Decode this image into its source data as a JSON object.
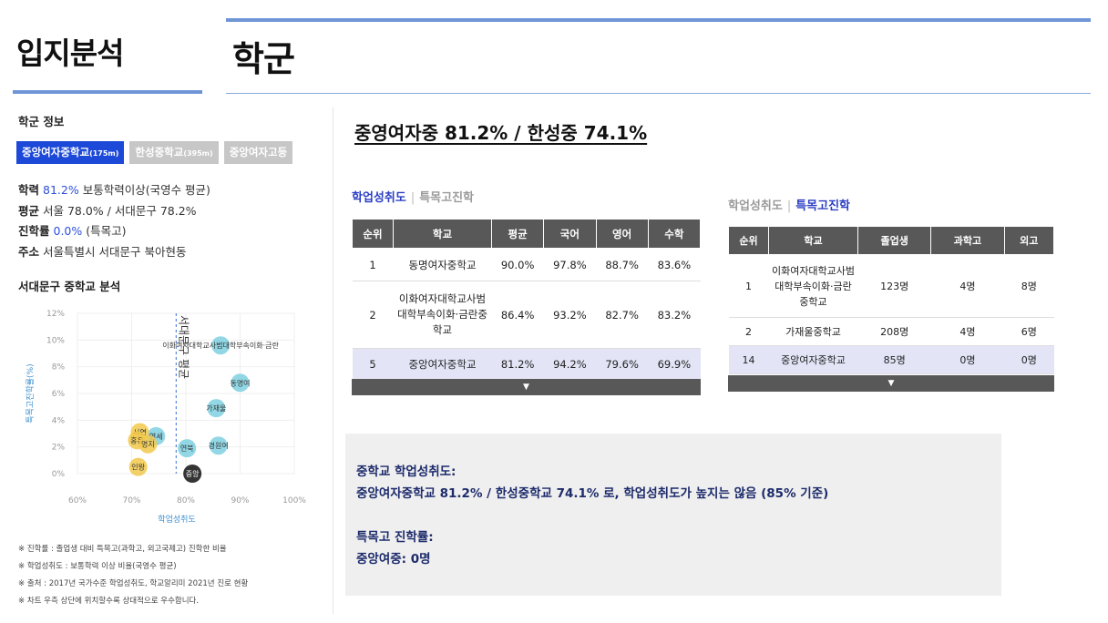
{
  "header": {
    "left_title": "입지분석",
    "right_title": "학군"
  },
  "left_panel": {
    "section_title": "학군 정보",
    "tabs": [
      {
        "label": "중앙여자중학교",
        "dist": "(175m)",
        "active": true
      },
      {
        "label": "한성중학교",
        "dist": "(395m)",
        "active": false
      },
      {
        "label": "중앙여자고등",
        "dist": "",
        "active": false
      }
    ],
    "info": {
      "hakryeok_label": "학력",
      "hakryeok_value": "81.2%",
      "hakryeok_rest": "보통학력이상(국영수 평균)",
      "avg_label": "평균",
      "avg_value": "서울 78.0% / 서대문구 78.2%",
      "jinhak_label": "진학률",
      "jinhak_value": "0.0%",
      "jinhak_rest": "(특목고)",
      "addr_label": "주소",
      "addr_value": "서울특별시 서대문구 북아현동"
    },
    "analysis_title": "서대문구 중학교 분석",
    "notes": [
      "※ 진학률 : 졸업생 대비 특목고(과학고, 외고국제고) 진학한 비율",
      "※ 학업성취도 : 보통학력 이상 비율(국영수 평균)",
      "※ 출처 : 2017년 국가수준 학업성취도, 학교알리미 2021년 진로 현황",
      "※ 차트 우측 상단에 위치할수록 상대적으로 우수합니다."
    ]
  },
  "chart_data": {
    "type": "scatter",
    "xlabel": "학업성취도",
    "ylabel": "특목고진학률(%)",
    "xlim": [
      60,
      100
    ],
    "ylim": [
      0,
      12
    ],
    "x_ticks": [
      "60%",
      "70%",
      "80%",
      "90%",
      "100%"
    ],
    "y_ticks": [
      "0%",
      "2%",
      "4%",
      "6%",
      "8%",
      "10%",
      "12%"
    ],
    "ref_line_label": "서대문구 평균",
    "ref_line_x": 78.2,
    "points": [
      {
        "label": "이화여자대학교사범대학부속이화·금란",
        "x": 86.4,
        "y": 9.6,
        "color": "#7fd0e0"
      },
      {
        "label": "동명여",
        "x": 90.0,
        "y": 6.8,
        "color": "#7fd0e0"
      },
      {
        "label": "가재울",
        "x": 85.6,
        "y": 4.9,
        "color": "#7fd0e0"
      },
      {
        "label": "경원여",
        "x": 86.0,
        "y": 2.1,
        "color": "#7fd0e0"
      },
      {
        "label": "연북",
        "x": 80.2,
        "y": 1.9,
        "color": "#7fd0e0"
      },
      {
        "label": "연세",
        "x": 74.5,
        "y": 2.8,
        "color": "#7fd0e0"
      },
      {
        "label": "서연",
        "x": 71.5,
        "y": 3.1,
        "color": "#f2c94c"
      },
      {
        "label": "홍은",
        "x": 71.0,
        "y": 2.5,
        "color": "#f2c94c"
      },
      {
        "label": "명지",
        "x": 73.0,
        "y": 2.2,
        "color": "#f2c94c"
      },
      {
        "label": "인왕",
        "x": 71.2,
        "y": 0.5,
        "color": "#f2c94c"
      },
      {
        "label": "중앙",
        "x": 81.2,
        "y": 0.0,
        "color": "#111111"
      }
    ]
  },
  "right_panel": {
    "headline": "중영여자중 81.2% / 한성중 74.1%",
    "left_table": {
      "tab_active": "학업성취도",
      "tab_inactive": "특목고진학",
      "headers": [
        "순위",
        "학교",
        "평균",
        "국어",
        "영어",
        "수학"
      ],
      "rows": [
        [
          "1",
          "동명여자중학교",
          "90.0%",
          "97.8%",
          "88.7%",
          "83.6%"
        ],
        [
          "2",
          "이화여자대학교사범대학부속이화·금란중학교",
          "86.4%",
          "93.2%",
          "82.7%",
          "83.2%"
        ],
        [
          "5",
          "중앙여자중학교",
          "81.2%",
          "94.2%",
          "79.6%",
          "69.9%"
        ]
      ],
      "more_icon": "▼"
    },
    "right_table": {
      "tab_inactive": "학업성취도",
      "tab_active": "특목고진학",
      "headers": [
        "순위",
        "학교",
        "졸업생",
        "과학고",
        "외고"
      ],
      "rows": [
        [
          "1",
          "이화여자대학교사범대학부속이화·금란중학교",
          "123명",
          "4명",
          "8명"
        ],
        [
          "2",
          "가재울중학교",
          "208명",
          "4명",
          "6명"
        ],
        [
          "14",
          "중앙여자중학교",
          "85명",
          "0명",
          "0명"
        ]
      ],
      "more_icon": "▼"
    },
    "summary": {
      "line1": "중학교 학업성취도:",
      "line2": "중앙여자중학교 81.2% / 한성중학교 74.1% 로, 학업성취도가 높지는 않음 (85% 기준)",
      "line3": "특목고 진학률:",
      "line4": "중앙여중: 0명"
    }
  }
}
